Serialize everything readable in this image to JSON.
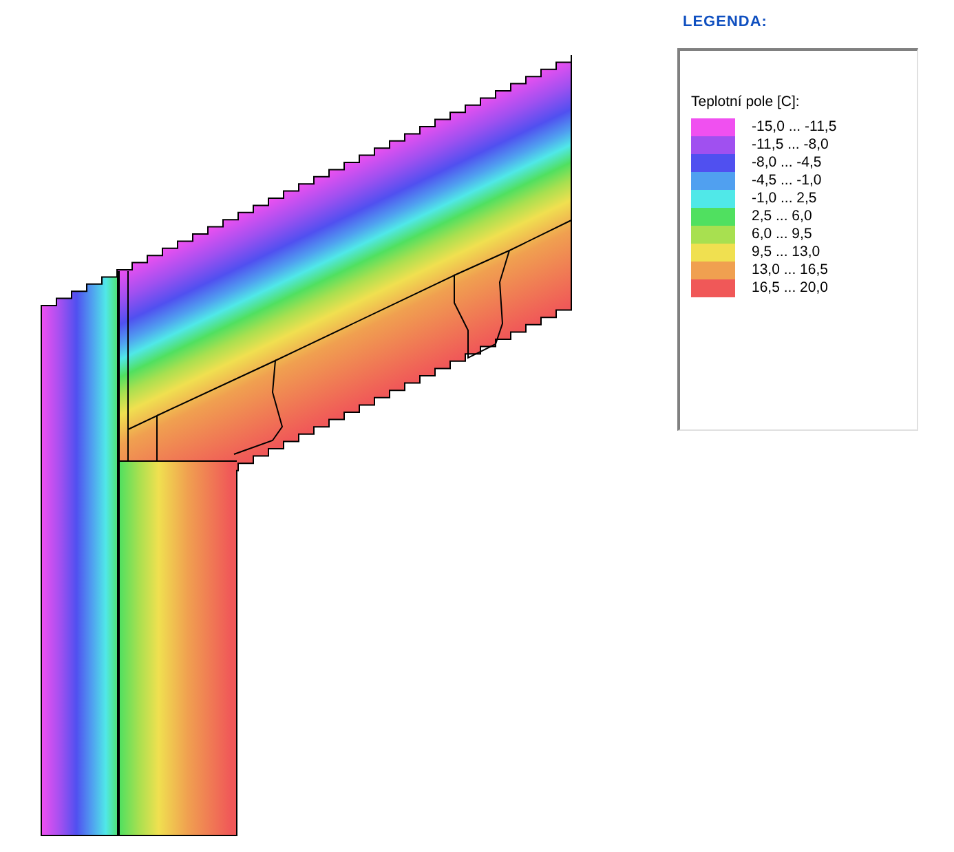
{
  "legend": {
    "title": "LEGENDA:",
    "label": "Teplotní pole [C]:",
    "entries": [
      {
        "range": "-15,0 ... -11,5",
        "color": "#f050f0"
      },
      {
        "range": "-11,5 ... -8,0",
        "color": "#a050f0"
      },
      {
        "range": "-8,0 ... -4,5",
        "color": "#5050f0"
      },
      {
        "range": "-4,5 ... -1,0",
        "color": "#50a0f0"
      },
      {
        "range": "-1,0 ... 2,5",
        "color": "#50e8e8"
      },
      {
        "range": "2,5 ... 6,0",
        "color": "#50e060"
      },
      {
        "range": "6,0 ... 9,5",
        "color": "#a8e050"
      },
      {
        "range": "9,5 ... 13,0",
        "color": "#f0e050"
      },
      {
        "range": "13,0 ... 16,5",
        "color": "#f0a050"
      },
      {
        "range": "16,5 ... 20,0",
        "color": "#f05858"
      }
    ]
  }
}
